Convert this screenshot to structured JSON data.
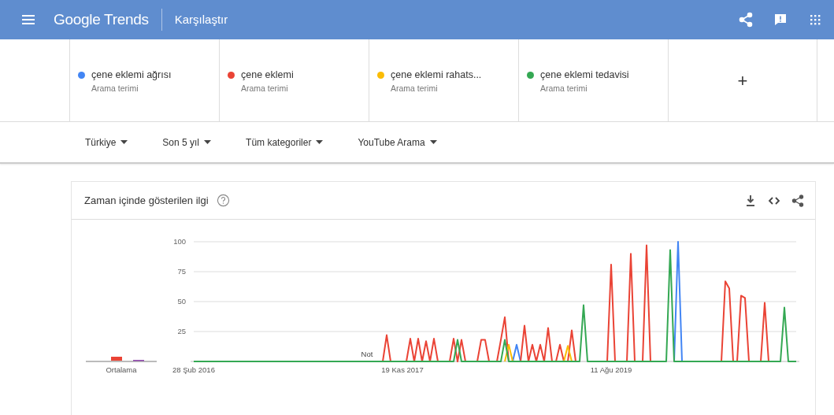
{
  "header": {
    "logo": "Google Trends",
    "title": "Karşılaştır"
  },
  "terms": [
    {
      "name": "çene eklemi ağrısı",
      "subtitle": "Arama terimi",
      "color": "#4285f4"
    },
    {
      "name": "çene eklemi",
      "subtitle": "Arama terimi",
      "color": "#ea4335"
    },
    {
      "name": "çene eklemi rahats...",
      "subtitle": "Arama terimi",
      "color": "#fbbc04"
    },
    {
      "name": "çene eklemi tedavisi",
      "subtitle": "Arama terimi",
      "color": "#34a853"
    }
  ],
  "add_term": "+",
  "filters": [
    {
      "label": "Türkiye"
    },
    {
      "label": "Son 5 yıl"
    },
    {
      "label": "Tüm kategoriler"
    },
    {
      "label": "YouTube Arama"
    }
  ],
  "interest_card": {
    "title": "Zaman içinde gösterilen ilgi",
    "average_label": "Ortalama",
    "chart_data": {
      "type": "line",
      "grid": true,
      "ylim": [
        0,
        100
      ],
      "yticks": [
        25,
        50,
        75,
        100
      ],
      "annotations": [
        "Not"
      ],
      "categories": [
        "28 Şub 2016",
        null,
        null,
        null,
        null,
        null,
        null,
        null,
        null,
        null,
        null,
        null,
        null,
        null,
        null,
        null,
        null,
        null,
        null,
        null,
        null,
        null,
        null,
        null,
        null,
        null,
        null,
        null,
        null,
        null,
        null,
        null,
        null,
        null,
        null,
        null,
        null,
        null,
        null,
        null,
        null,
        null,
        null,
        null,
        null,
        null,
        null,
        null,
        null,
        null,
        null,
        null,
        null,
        "19 Kas 2017",
        null,
        null,
        null,
        null,
        null,
        null,
        null,
        null,
        null,
        null,
        null,
        null,
        null,
        null,
        null,
        null,
        null,
        null,
        null,
        null,
        null,
        null,
        null,
        null,
        null,
        null,
        null,
        null,
        null,
        null,
        null,
        null,
        null,
        null,
        null,
        null,
        null,
        null,
        null,
        null,
        null,
        null,
        null,
        null,
        null,
        null,
        null,
        null,
        null,
        null,
        null,
        null,
        "11 Ağu 2019",
        null,
        null,
        null,
        null,
        null,
        null,
        null,
        null,
        null,
        null,
        null,
        null,
        null,
        null,
        null,
        null,
        null,
        null,
        null,
        null,
        null,
        null,
        null,
        null,
        null,
        null,
        null,
        null,
        null,
        null,
        null,
        null,
        null,
        null,
        null,
        null,
        null,
        null,
        null,
        null,
        null,
        null,
        null,
        null,
        null,
        null,
        null
      ],
      "series": [
        {
          "color": "#4285f4",
          "values": [
            null,
            null,
            null,
            null,
            null,
            null,
            null,
            null,
            null,
            null,
            null,
            null,
            null,
            null,
            null,
            null,
            null,
            null,
            null,
            null,
            null,
            null,
            null,
            null,
            null,
            null,
            null,
            null,
            null,
            null,
            null,
            null,
            null,
            null,
            null,
            null,
            null,
            null,
            null,
            null,
            null,
            null,
            null,
            null,
            null,
            null,
            null,
            null,
            null,
            null,
            null,
            null,
            null,
            null,
            null,
            null,
            null,
            null,
            null,
            null,
            null,
            null,
            null,
            null,
            null,
            null,
            null,
            null,
            null,
            null,
            null,
            null,
            null,
            null,
            null,
            null,
            null,
            null,
            null,
            null,
            null,
            0,
            14,
            0,
            null,
            null,
            null,
            null,
            null,
            null,
            null,
            null,
            null,
            null,
            null,
            null,
            null,
            null,
            null,
            null,
            null,
            null,
            null,
            null,
            null,
            null,
            null,
            null,
            null,
            null,
            null,
            null,
            null,
            null,
            null,
            null,
            null,
            null,
            null,
            null,
            null,
            null,
            0,
            100,
            0,
            null,
            null,
            null,
            null,
            null,
            null,
            null,
            null,
            null,
            null,
            null,
            null,
            null,
            null,
            null,
            null,
            null,
            null,
            null,
            null,
            null,
            null,
            null,
            null,
            null,
            null,
            null,
            null,
            null
          ]
        },
        {
          "color": "#ea4335",
          "values": [
            null,
            null,
            null,
            null,
            null,
            null,
            null,
            null,
            null,
            null,
            null,
            null,
            null,
            null,
            null,
            null,
            null,
            null,
            null,
            null,
            null,
            null,
            null,
            null,
            null,
            null,
            null,
            null,
            null,
            null,
            null,
            null,
            null,
            null,
            null,
            null,
            null,
            null,
            null,
            null,
            null,
            null,
            null,
            null,
            null,
            null,
            null,
            null,
            0,
            22,
            0,
            null,
            null,
            null,
            0,
            19,
            0,
            19,
            0,
            17,
            0,
            19,
            0,
            null,
            null,
            0,
            19,
            0,
            18,
            0,
            null,
            null,
            0,
            18,
            18,
            0,
            null,
            0,
            18,
            37,
            0,
            null,
            null,
            0,
            30,
            0,
            14,
            0,
            14,
            0,
            28,
            0,
            0,
            14,
            0,
            0,
            26,
            0,
            null,
            null,
            null,
            null,
            null,
            null,
            null,
            0,
            81,
            0,
            null,
            null,
            0,
            90,
            0,
            null,
            0,
            97,
            0,
            null,
            null,
            null,
            null,
            null,
            null,
            null,
            null,
            null,
            null,
            null,
            null,
            null,
            null,
            null,
            null,
            null,
            0,
            67,
            61,
            0,
            0,
            55,
            53,
            0,
            null,
            null,
            0,
            49,
            0,
            null,
            null,
            null,
            null,
            null,
            null,
            null
          ]
        },
        {
          "color": "#fbbc04",
          "values": [
            null,
            null,
            null,
            null,
            null,
            null,
            null,
            null,
            null,
            null,
            null,
            null,
            null,
            null,
            null,
            null,
            null,
            null,
            null,
            null,
            null,
            null,
            null,
            null,
            null,
            null,
            null,
            null,
            null,
            null,
            null,
            null,
            null,
            null,
            null,
            null,
            null,
            null,
            null,
            null,
            null,
            null,
            null,
            null,
            null,
            null,
            null,
            null,
            null,
            null,
            null,
            null,
            null,
            null,
            null,
            null,
            null,
            null,
            null,
            null,
            null,
            null,
            null,
            null,
            null,
            null,
            null,
            null,
            null,
            null,
            null,
            null,
            null,
            null,
            null,
            null,
            null,
            null,
            null,
            0,
            14,
            0,
            null,
            null,
            null,
            null,
            null,
            null,
            null,
            null,
            null,
            null,
            null,
            null,
            0,
            13,
            0,
            null,
            null,
            null,
            null,
            null,
            null,
            null,
            null,
            null,
            null,
            null,
            null,
            null,
            null,
            null,
            null,
            null,
            null,
            null,
            null,
            null,
            null,
            null,
            null,
            null,
            null,
            null,
            null,
            null,
            null,
            null,
            null,
            null,
            null,
            null,
            null,
            null,
            null,
            null,
            null,
            null,
            null,
            null,
            null,
            null,
            null,
            null,
            null,
            null,
            null,
            null,
            null,
            null,
            null,
            null,
            null,
            null
          ]
        },
        {
          "color": "#34a853",
          "values": [
            0,
            0,
            0,
            0,
            0,
            0,
            0,
            0,
            0,
            0,
            0,
            0,
            0,
            0,
            0,
            0,
            0,
            0,
            0,
            0,
            0,
            0,
            0,
            0,
            0,
            0,
            0,
            0,
            0,
            0,
            0,
            0,
            0,
            0,
            0,
            0,
            0,
            0,
            0,
            0,
            0,
            0,
            0,
            0,
            0,
            0,
            0,
            0,
            0,
            0,
            0,
            0,
            0,
            0,
            0,
            0,
            0,
            0,
            0,
            0,
            0,
            0,
            0,
            0,
            0,
            0,
            0,
            18,
            0,
            0,
            0,
            0,
            0,
            0,
            0,
            0,
            0,
            0,
            0,
            18,
            0,
            0,
            0,
            0,
            0,
            0,
            0,
            0,
            0,
            0,
            0,
            0,
            0,
            0,
            0,
            0,
            0,
            0,
            0,
            47,
            0,
            0,
            0,
            0,
            0,
            0,
            0,
            0,
            0,
            0,
            0,
            0,
            0,
            0,
            0,
            0,
            0,
            0,
            0,
            0,
            0,
            93,
            0,
            0,
            0,
            0,
            0,
            0,
            0,
            0,
            0,
            0,
            0,
            0,
            0,
            0,
            0,
            0,
            0,
            0,
            0,
            0,
            0,
            0,
            0,
            0,
            0,
            0,
            0,
            0,
            45,
            0,
            0,
            0
          ]
        }
      ]
    }
  }
}
